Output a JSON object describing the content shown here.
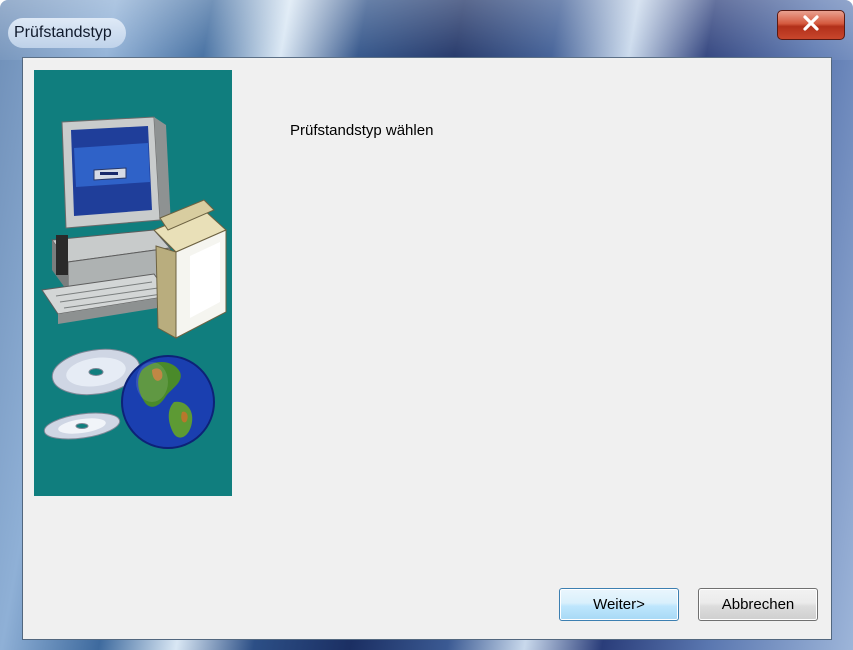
{
  "window": {
    "title": "Prüfstandstyp",
    "close_icon": "close-icon"
  },
  "main": {
    "heading": "Prüfstandstyp wählen",
    "illustration_icons": [
      "computer-icon",
      "software-box-icon",
      "cd-icon",
      "globe-icon"
    ]
  },
  "buttons": {
    "next_label": "Weiter>",
    "cancel_label": "Abbrechen"
  },
  "colors": {
    "client_background": "#f0f0f0",
    "illustration_background": "#107e7e",
    "close_button": "#c8462c",
    "default_button_border": "#3c7fb1"
  }
}
